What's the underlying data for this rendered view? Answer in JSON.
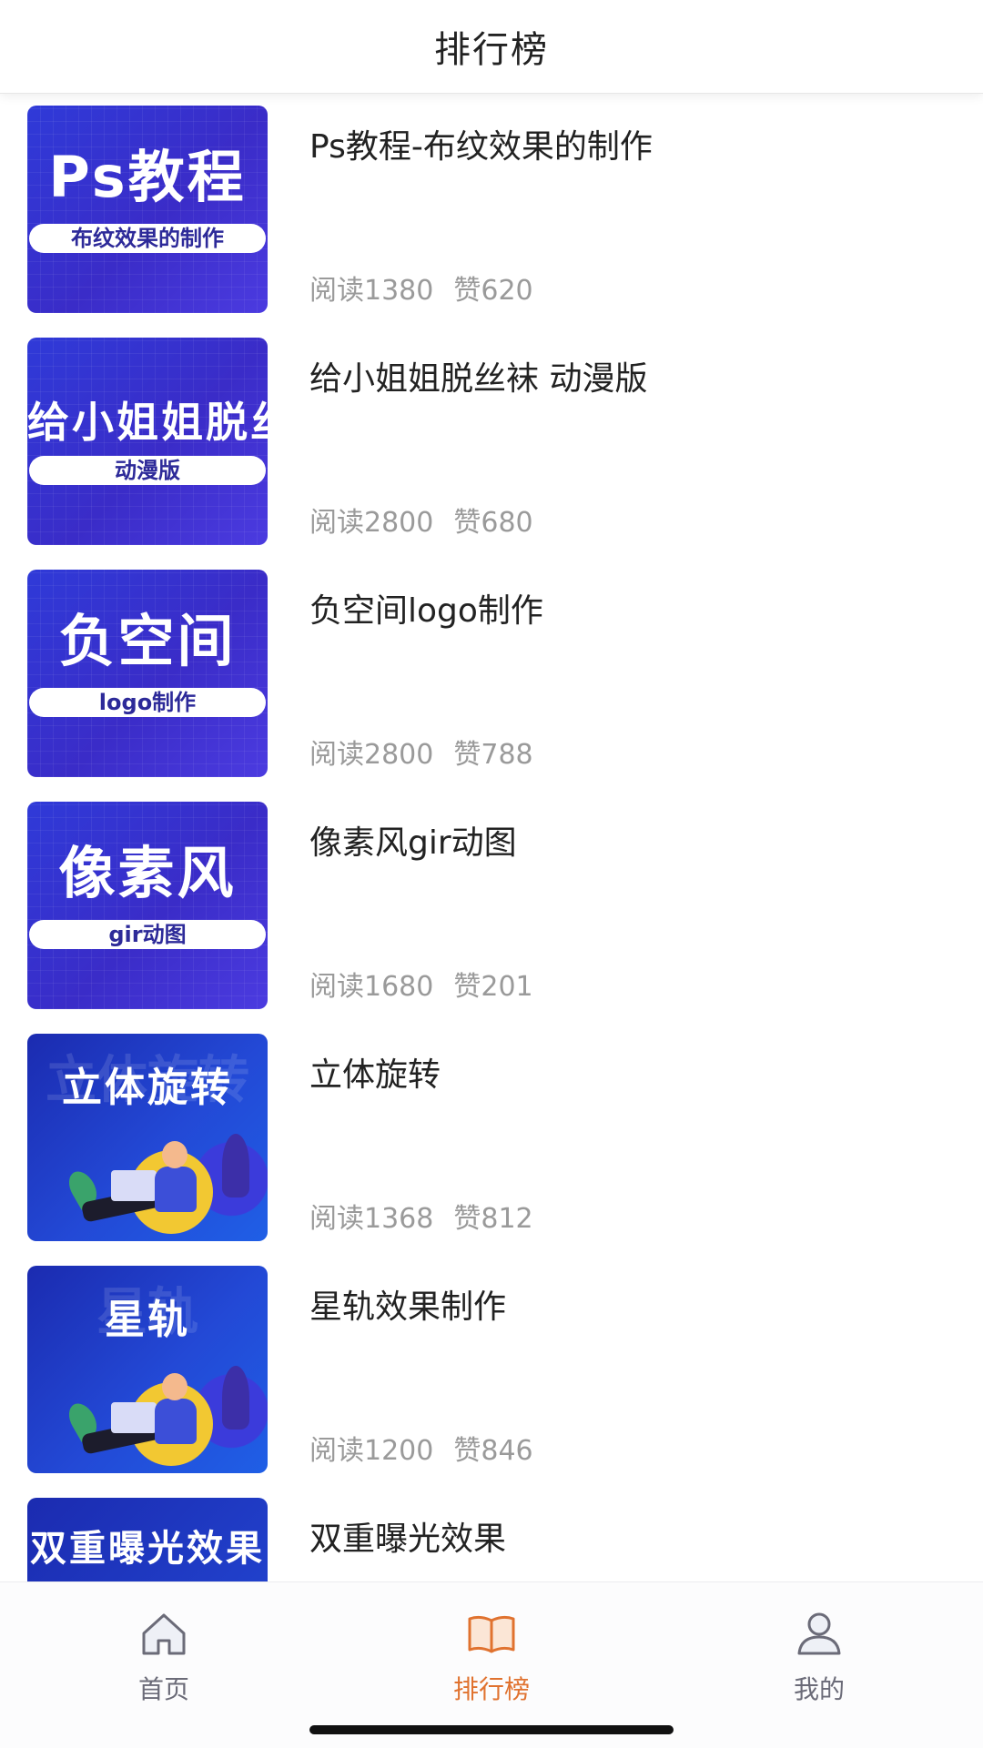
{
  "header": {
    "title": "排行榜"
  },
  "items": [
    {
      "thumb_title": "Ps教程",
      "thumb_sub": "布纹效果的制作",
      "title": "Ps教程-布纹效果的制作",
      "reads": "阅读1380",
      "likes": "赞620"
    },
    {
      "thumb_title": "给小姐姐脱丝袜",
      "thumb_sub": "动漫版",
      "title": "给小姐姐脱丝袜 动漫版",
      "reads": "阅读2800",
      "likes": "赞680"
    },
    {
      "thumb_title": "负空间",
      "thumb_sub": "logo制作",
      "title": "负空间logo制作",
      "reads": "阅读2800",
      "likes": "赞788"
    },
    {
      "thumb_title": "像素风",
      "thumb_sub": "gir动图",
      "title": "像素风gir动图",
      "reads": "阅读1680",
      "likes": "赞201"
    },
    {
      "thumb_title": "立体旋转",
      "title": "立体旋转",
      "reads": "阅读1368",
      "likes": "赞812"
    },
    {
      "thumb_title": "星轨",
      "title": "星轨效果制作",
      "reads": "阅读1200",
      "likes": "赞846"
    },
    {
      "thumb_title": "双重曝光效果",
      "title": "双重曝光效果"
    }
  ],
  "tabs": [
    {
      "label": "首页",
      "icon": "home-icon",
      "active": false
    },
    {
      "label": "排行榜",
      "icon": "book-icon",
      "active": true,
      "color": "#e0722f"
    },
    {
      "label": "我的",
      "icon": "user-icon",
      "active": false
    }
  ]
}
